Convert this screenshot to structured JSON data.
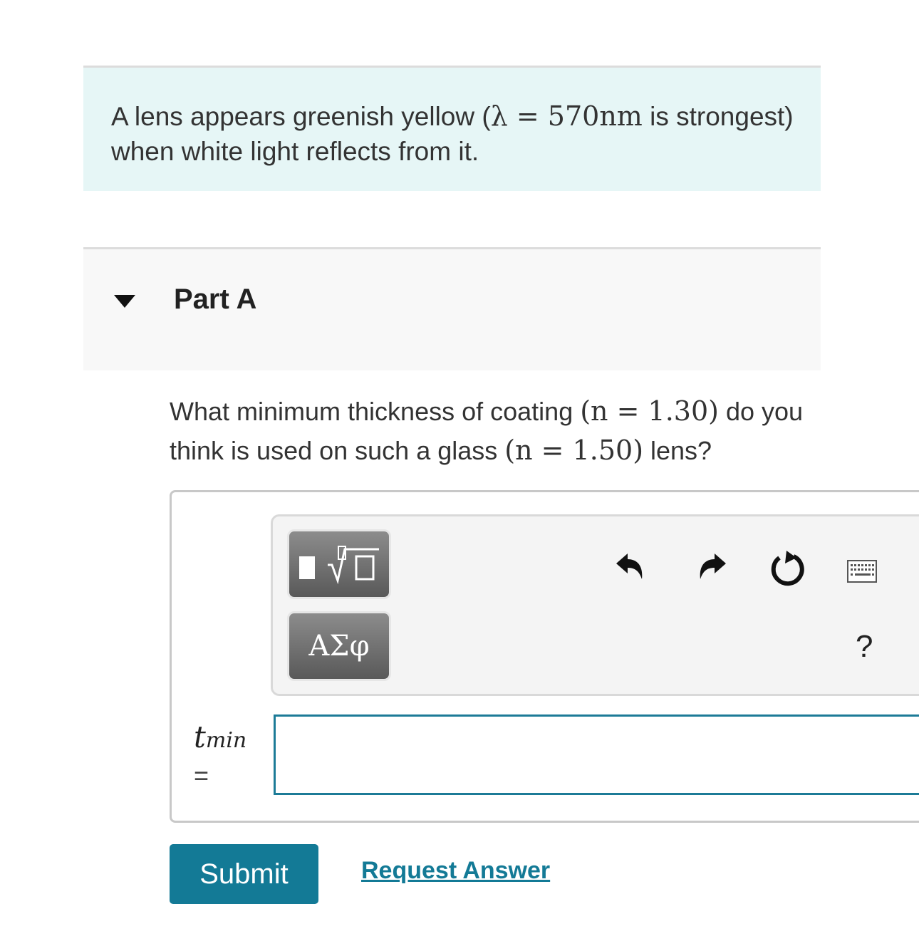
{
  "problem": {
    "intro_before": "A lens appears greenish yellow (",
    "intro_math": "λ = 570nm",
    "intro_after": " is strongest) when white light reflects from it."
  },
  "part": {
    "title": "Part A",
    "question_a": "What minimum thickness of coating ",
    "question_math1": "(n = 1.30)",
    "question_b": " do you think is used on such a glass ",
    "question_math2": "(n = 1.50)",
    "question_c": " lens?"
  },
  "toolbar": {
    "greek_label": "ΑΣφ",
    "help_label": "?",
    "icons": [
      "templates-icon",
      "undo-icon",
      "redo-icon",
      "reset-icon",
      "keyboard-icon",
      "help-icon"
    ]
  },
  "answer": {
    "variable": "t",
    "subscript": "min",
    "equals": "=",
    "value": ""
  },
  "actions": {
    "submit_label": "Submit",
    "request_label": "Request Answer"
  }
}
